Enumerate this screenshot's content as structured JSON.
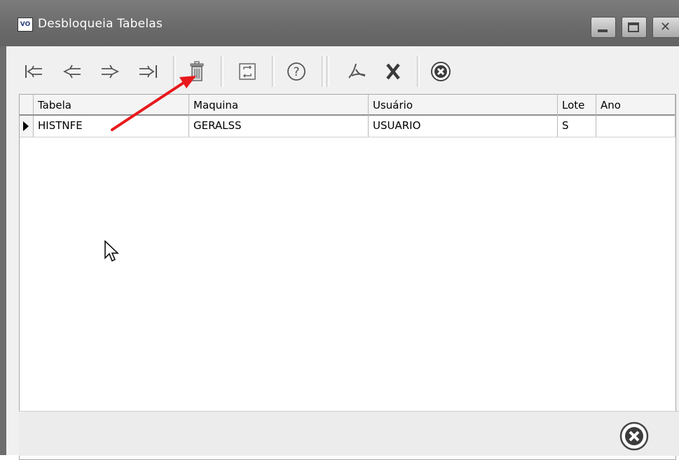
{
  "window": {
    "icon_text": "VO",
    "title": "Desbloqueia Tabelas"
  },
  "toolbar": {
    "items": [
      {
        "name": "first-record",
        "icon": "first-icon"
      },
      {
        "name": "prev-record",
        "icon": "prev-icon"
      },
      {
        "name": "next-record",
        "icon": "next-icon"
      },
      {
        "name": "last-record",
        "icon": "last-icon"
      },
      {
        "name": "delete",
        "icon": "trash-icon"
      },
      {
        "name": "refresh",
        "icon": "refresh-icon"
      },
      {
        "name": "help",
        "icon": "help-icon"
      },
      {
        "name": "pdf",
        "icon": "pdf-icon"
      },
      {
        "name": "excel",
        "icon": "excel-icon"
      },
      {
        "name": "close",
        "icon": "close-circle-icon"
      }
    ]
  },
  "grid": {
    "columns": [
      "Tabela",
      "Maquina",
      "Usuário",
      "Lote",
      "Ano"
    ],
    "rows": [
      [
        "HISTNFE",
        "GERALSS",
        "USUARIO",
        "S",
        ""
      ]
    ]
  },
  "annotation": {
    "arrow_color": "#e8191c"
  }
}
